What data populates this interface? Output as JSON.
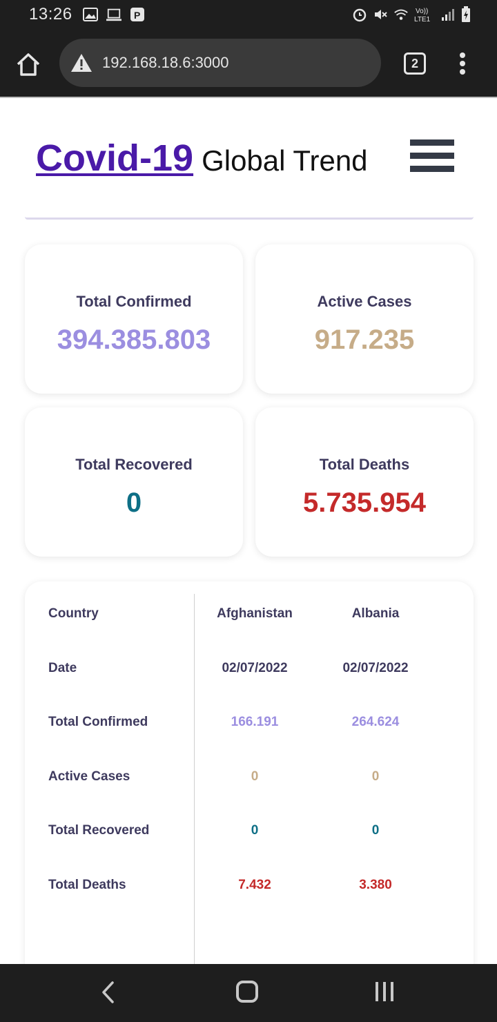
{
  "status_bar": {
    "time": "13:26",
    "left_icons": [
      "image-icon",
      "laptop-icon",
      "parking-icon"
    ],
    "right_icons": [
      "alarm-icon",
      "mute-icon",
      "wifi-icon",
      "volte-icon",
      "signal-icon",
      "battery-icon"
    ],
    "volte_label": "Vo)) LTE1"
  },
  "browser": {
    "url": "192.168.18.6:3000",
    "tab_count": "2"
  },
  "header": {
    "brand": "Covid-19",
    "subtitle": "Global Trend"
  },
  "summary": {
    "total_confirmed": {
      "label": "Total Confirmed",
      "value": "394.385.803"
    },
    "active_cases": {
      "label": "Active Cases",
      "value": "917.235"
    },
    "total_recovered": {
      "label": "Total Recovered",
      "value": "0"
    },
    "total_deaths": {
      "label": "Total Deaths",
      "value": "5.735.954"
    }
  },
  "table": {
    "labels": {
      "country": "Country",
      "date": "Date",
      "confirmed": "Total Confirmed",
      "active": "Active Cases",
      "recovered": "Total Recovered",
      "deaths": "Total Deaths"
    },
    "countries": [
      {
        "country": "Afghanistan",
        "date": "02/07/2022",
        "confirmed": "166.191",
        "active": "0",
        "recovered": "0",
        "deaths": "7.432"
      },
      {
        "country": "Albania",
        "date": "02/07/2022",
        "confirmed": "264.624",
        "active": "0",
        "recovered": "0",
        "deaths": "3.380"
      }
    ]
  },
  "colors": {
    "brand": "#4a1aa8",
    "confirmed": "#9b8ee0",
    "active": "#c6ac88",
    "recovered": "#0e6f86",
    "deaths": "#c42a2a",
    "label": "#3e3a5e"
  }
}
